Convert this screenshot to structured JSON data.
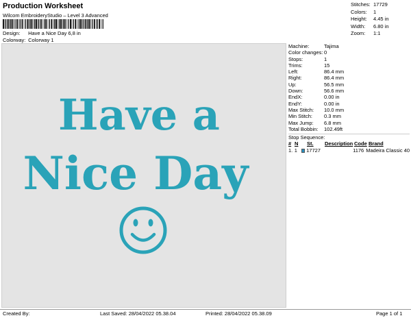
{
  "header": {
    "title": "Production Worksheet",
    "software": "Wilcom EmbroideryStudio – Level 3 Advanced",
    "design_label": "Design:",
    "design_value": "Have a Nice Day 6,8 in",
    "colorway_label": "Colorway:",
    "colorway_value": "Colorway 1"
  },
  "summary": [
    {
      "k": "Stitches:",
      "v": "17729"
    },
    {
      "k": "Colors:",
      "v": "1"
    },
    {
      "k": "Height:",
      "v": "4.45 in"
    },
    {
      "k": "Width:",
      "v": "6.80 in"
    },
    {
      "k": "Zoom:",
      "v": "1:1"
    }
  ],
  "design": {
    "line1": "Have a",
    "line2": "Nice Day",
    "thread_color": "#2aa3b8",
    "background_color": "#e4e4e4"
  },
  "machine_info": [
    {
      "k": "Machine:",
      "v": "Tajima"
    },
    {
      "k": "Color changes:",
      "v": "0"
    },
    {
      "k": "Stops:",
      "v": "1"
    },
    {
      "k": "Trims:",
      "v": "15"
    },
    {
      "k": "Left:",
      "v": "86.4 mm"
    },
    {
      "k": "Right:",
      "v": "86.4 mm"
    },
    {
      "k": "Up:",
      "v": "56.5 mm"
    },
    {
      "k": "Down:",
      "v": "56.6 mm"
    },
    {
      "k": "EndX:",
      "v": "0.00 in"
    },
    {
      "k": "EndY:",
      "v": "0.00 in"
    },
    {
      "k": "Max Stitch:",
      "v": "10.0 mm"
    },
    {
      "k": "Min Stitch:",
      "v": "0.3 mm"
    },
    {
      "k": "Max Jump:",
      "v": "6.8 mm"
    },
    {
      "k": "Total Bobbin:",
      "v": "102.49ft"
    }
  ],
  "stop_sequence": {
    "title": "Stop Sequence:",
    "headers": {
      "num": "#",
      "n": "N",
      "st": "St.",
      "desc": "Description",
      "code": "Code",
      "brand": "Brand"
    },
    "rows": [
      {
        "num": "1.",
        "n": "1",
        "color": "#2a8fc0",
        "st": "17727",
        "desc": "",
        "code": "1176",
        "brand": "Madeira Classic 40"
      }
    ]
  },
  "footer": {
    "created_by": "Created By:",
    "last_saved": "Last Saved: 28/04/2022 05.38.04",
    "printed": "Printed: 28/04/2022 05.38.09",
    "page": "Page 1 of 1"
  }
}
